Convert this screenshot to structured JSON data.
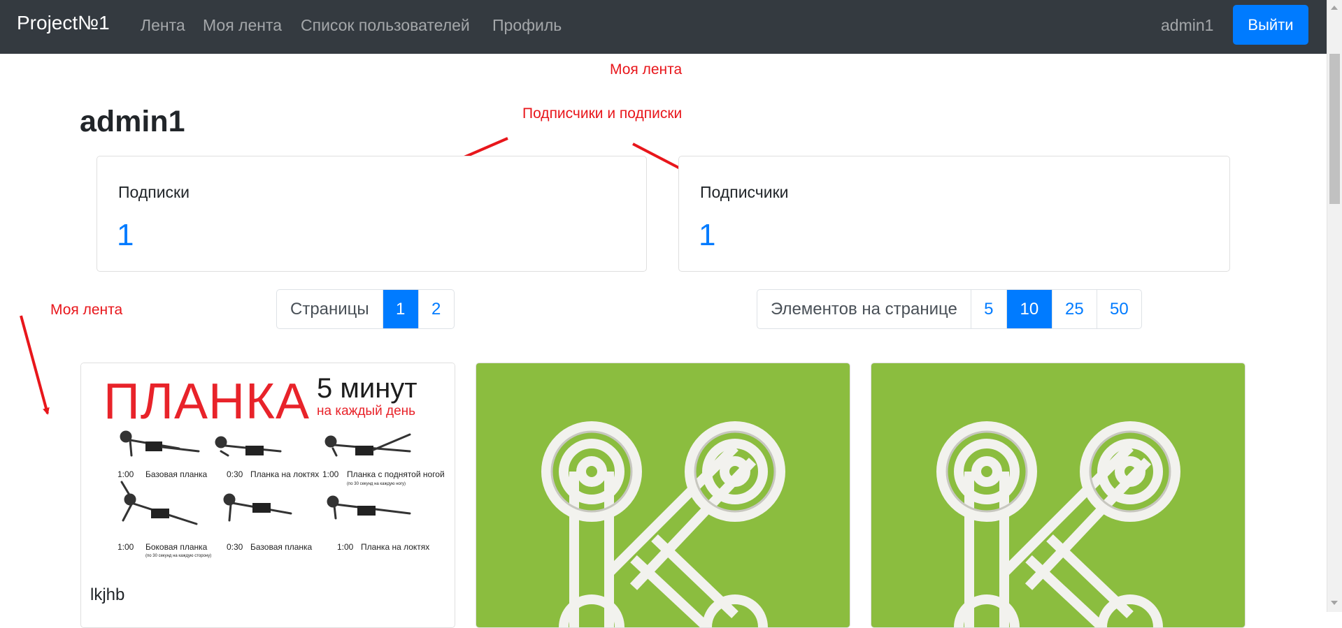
{
  "navbar": {
    "brand": "Project№1",
    "links": [
      "Лента",
      "Моя лента",
      "Список пользователей",
      "Профиль"
    ],
    "username": "admin1",
    "logout_label": "Выйти"
  },
  "annotations": {
    "top": "Моя лента",
    "stats": "Подписчики и подписки",
    "feed": "Моя лента"
  },
  "profile": {
    "title": "admin1",
    "subscriptions_label": "Подписки",
    "subscriptions_count": "1",
    "subscribers_label": "Подписчики",
    "subscribers_count": "1"
  },
  "pagination": {
    "pages_label": "Страницы",
    "pages": [
      "1",
      "2"
    ],
    "active_page": "1",
    "size_label": "Элементов на странице",
    "sizes": [
      "5",
      "10",
      "25",
      "50"
    ],
    "active_size": "10"
  },
  "posts": [
    {
      "caption": "lkjhb",
      "image": {
        "title": "ПЛАНКА",
        "subtitle": "5 минут",
        "subtitle2": "на каждый день",
        "exercises": [
          {
            "time": "1:00",
            "name": "Базовая планка",
            "note": ""
          },
          {
            "time": "0:30",
            "name": "Планка на локтях",
            "note": ""
          },
          {
            "time": "1:00",
            "name": "Планка с поднятой ногой",
            "note": "(по 30 секунд на каждую ногу)"
          },
          {
            "time": "1:00",
            "name": "Боковая планка",
            "note": "(по 30 секунд на каждую сторону)"
          },
          {
            "time": "0:30",
            "name": "Базовая планка",
            "note": ""
          },
          {
            "time": "1:00",
            "name": "Планка на локтях",
            "note": ""
          }
        ]
      }
    },
    {
      "caption": "",
      "image": {
        "kind": "green-k-logo"
      }
    },
    {
      "caption": "",
      "image": {
        "kind": "green-k-logo"
      }
    }
  ],
  "colors": {
    "navbar": "#343a40",
    "primary": "#007bff",
    "annotation": "#e8161b",
    "logo_green": "#8bbd3f"
  }
}
